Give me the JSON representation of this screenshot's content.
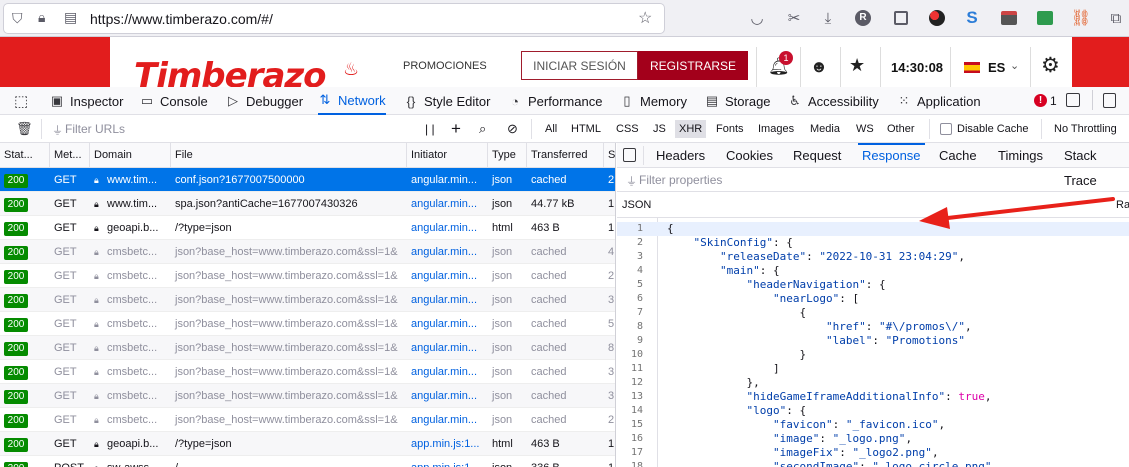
{
  "browser": {
    "url": "https://www.timberazo.com/#/",
    "url_icons": [
      "shield-icon",
      "lock-icon",
      "reader-icon"
    ],
    "toolbar_icons": [
      "bookmark-star-icon",
      "pocket-icon",
      "screenshot-icon",
      "download-icon",
      "extension-r-icon",
      "extension-grid-icon",
      "extension-ball-icon",
      "extension-s-icon",
      "extension-dark-icon",
      "extension-green-icon",
      "extension-link-icon",
      "puzzle-icon"
    ]
  },
  "site": {
    "logo_text": "Timberazo",
    "promo_label": "PROMOCIONES",
    "login_label": "INICIAR SESIÓN",
    "register_label": "REGISTRARSE",
    "notification_count": "1",
    "time": "14:30:08",
    "language": "ES"
  },
  "devtools": {
    "tabs": [
      {
        "label": "Inspector",
        "icon": "inspector-icon"
      },
      {
        "label": "Console",
        "icon": "console-icon"
      },
      {
        "label": "Debugger",
        "icon": "debugger-icon"
      },
      {
        "label": "Network",
        "icon": "network-icon",
        "active": true
      },
      {
        "label": "Style Editor",
        "icon": "style-editor-icon"
      },
      {
        "label": "Performance",
        "icon": "performance-icon"
      },
      {
        "label": "Memory",
        "icon": "memory-icon"
      },
      {
        "label": "Storage",
        "icon": "storage-icon"
      },
      {
        "label": "Accessibility",
        "icon": "accessibility-icon"
      },
      {
        "label": "Application",
        "icon": "application-icon"
      }
    ],
    "error_count": "1"
  },
  "filter": {
    "placeholder": "Filter URLs",
    "pause_label": "| |",
    "add_label": "+",
    "types": [
      "All",
      "HTML",
      "CSS",
      "JS",
      "XHR",
      "Fonts",
      "Images",
      "Media",
      "WS",
      "Other"
    ],
    "active_type": "XHR",
    "disable_cache_label": "Disable Cache",
    "throttling_label": "No Throttling"
  },
  "table": {
    "columns": [
      "Stat...",
      "Met...",
      "Domain",
      "File",
      "Initiator",
      "Type",
      "Transferred",
      "S"
    ],
    "rows": [
      {
        "status": "200",
        "method": "GET",
        "domain": "www.tim...",
        "file": "conf.json?1677007500000",
        "initiator": "angular.min...",
        "type": "json",
        "transferred": "cached",
        "size": "2",
        "selected": true,
        "dim": false
      },
      {
        "status": "200",
        "method": "GET",
        "domain": "www.tim...",
        "file": "spa.json?antiCache=1677007430326",
        "initiator": "angular.min...",
        "type": "json",
        "transferred": "44.77 kB",
        "size": "1",
        "selected": false,
        "dim": false
      },
      {
        "status": "200",
        "method": "GET",
        "domain": "geoapi.b...",
        "file": "/?type=json",
        "initiator": "angular.min...",
        "type": "html",
        "transferred": "463 B",
        "size": "1",
        "selected": false,
        "dim": false
      },
      {
        "status": "200",
        "method": "GET",
        "domain": "cmsbetc...",
        "file": "json?base_host=www.timberazo.com&ssl=1&",
        "initiator": "angular.min...",
        "type": "json",
        "transferred": "cached",
        "size": "4",
        "selected": false,
        "dim": true
      },
      {
        "status": "200",
        "method": "GET",
        "domain": "cmsbetc...",
        "file": "json?base_host=www.timberazo.com&ssl=1&",
        "initiator": "angular.min...",
        "type": "json",
        "transferred": "cached",
        "size": "2",
        "selected": false,
        "dim": true
      },
      {
        "status": "200",
        "method": "GET",
        "domain": "cmsbetc...",
        "file": "json?base_host=www.timberazo.com&ssl=1&",
        "initiator": "angular.min...",
        "type": "json",
        "transferred": "cached",
        "size": "3",
        "selected": false,
        "dim": true
      },
      {
        "status": "200",
        "method": "GET",
        "domain": "cmsbetc...",
        "file": "json?base_host=www.timberazo.com&ssl=1&",
        "initiator": "angular.min...",
        "type": "json",
        "transferred": "cached",
        "size": "5",
        "selected": false,
        "dim": true
      },
      {
        "status": "200",
        "method": "GET",
        "domain": "cmsbetc...",
        "file": "json?base_host=www.timberazo.com&ssl=1&",
        "initiator": "angular.min...",
        "type": "json",
        "transferred": "cached",
        "size": "8",
        "selected": false,
        "dim": true
      },
      {
        "status": "200",
        "method": "GET",
        "domain": "cmsbetc...",
        "file": "json?base_host=www.timberazo.com&ssl=1&",
        "initiator": "angular.min...",
        "type": "json",
        "transferred": "cached",
        "size": "3",
        "selected": false,
        "dim": true
      },
      {
        "status": "200",
        "method": "GET",
        "domain": "cmsbetc...",
        "file": "json?base_host=www.timberazo.com&ssl=1&",
        "initiator": "angular.min...",
        "type": "json",
        "transferred": "cached",
        "size": "3",
        "selected": false,
        "dim": true
      },
      {
        "status": "200",
        "method": "GET",
        "domain": "cmsbetc...",
        "file": "json?base_host=www.timberazo.com&ssl=1&",
        "initiator": "angular.min...",
        "type": "json",
        "transferred": "cached",
        "size": "2",
        "selected": false,
        "dim": true
      },
      {
        "status": "200",
        "method": "GET",
        "domain": "geoapi.b...",
        "file": "/?type=json",
        "initiator": "app.min.js:1...",
        "type": "html",
        "transferred": "463 B",
        "size": "1",
        "selected": false,
        "dim": false
      },
      {
        "status": "200",
        "method": "POST",
        "domain": "sw-awss...",
        "file": "/",
        "initiator": "app.min.js:1...",
        "type": "json",
        "transferred": "336 B",
        "size": "1",
        "selected": false,
        "dim": false
      }
    ]
  },
  "panel": {
    "tabs": [
      "Headers",
      "Cookies",
      "Request",
      "Response",
      "Cache",
      "Timings",
      "Stack Trace"
    ],
    "active_tab": "Response",
    "filter_placeholder": "Filter properties",
    "json_label": "JSON",
    "raw_label": "Ra",
    "code_lines": [
      {
        "n": "1",
        "t": "{"
      },
      {
        "n": "2",
        "t": "    \"SkinConfig\": {"
      },
      {
        "n": "3",
        "t": "        \"releaseDate\": \"2022-10-31 23:04:29\","
      },
      {
        "n": "4",
        "t": "        \"main\": {"
      },
      {
        "n": "5",
        "t": "            \"headerNavigation\": {"
      },
      {
        "n": "6",
        "t": "                \"nearLogo\": ["
      },
      {
        "n": "7",
        "t": "                    {"
      },
      {
        "n": "8",
        "t": "                        \"href\": \"#\\/promos\\/\","
      },
      {
        "n": "9",
        "t": "                        \"label\": \"Promotions\""
      },
      {
        "n": "10",
        "t": "                    }"
      },
      {
        "n": "11",
        "t": "                ]"
      },
      {
        "n": "12",
        "t": "            },"
      },
      {
        "n": "13",
        "t": "            \"hideGameIframeAdditionalInfo\": true,"
      },
      {
        "n": "14",
        "t": "            \"logo\": {"
      },
      {
        "n": "15",
        "t": "                \"favicon\": \"_favicon.ico\","
      },
      {
        "n": "16",
        "t": "                \"image\": \"_logo.png\","
      },
      {
        "n": "17",
        "t": "                \"imageFix\": \"_logo2.png\","
      },
      {
        "n": "18",
        "t": "                \"secondImage\": \"_logo_circle.png\","
      }
    ]
  },
  "colors": {
    "accent": "#0061e0",
    "selected_row": "#0074e8",
    "status_ok": "#058b00",
    "site_red": "#e21d1d",
    "register_bg": "#a3001b",
    "annotation_arrow": "#e8211a"
  }
}
